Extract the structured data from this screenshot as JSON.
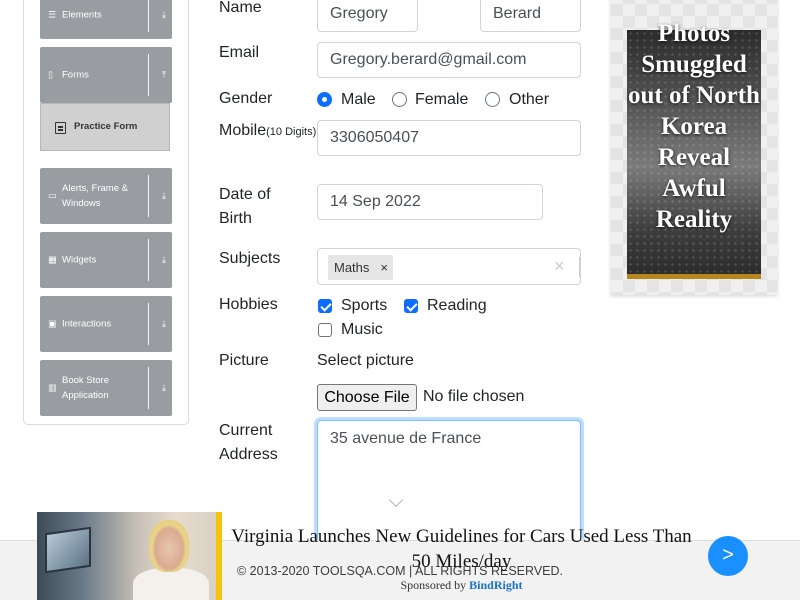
{
  "sidebar": {
    "groups": [
      {
        "label": "Elements",
        "icon": "list-icon"
      },
      {
        "label": "Forms",
        "icon": "document-icon"
      },
      {
        "label": "Alerts, Frame & Windows",
        "icon": "window-icon"
      },
      {
        "label": "Widgets",
        "icon": "grid-icon"
      },
      {
        "label": "Interactions",
        "icon": "interaction-icon"
      },
      {
        "label": "Book Store Application",
        "icon": "book-icon"
      }
    ],
    "active_item": {
      "label": "Practice Form",
      "icon": "form-icon"
    }
  },
  "form": {
    "name_label": "Name",
    "first_name": "Gregory",
    "last_name": "Berard",
    "email_label": "Email",
    "email": "Gregory.berard@gmail.com",
    "gender_label": "Gender",
    "gender_options": [
      "Male",
      "Female",
      "Other"
    ],
    "gender_selected": "Male",
    "mobile_label": "Mobile",
    "mobile_hint": "(10 Digits)",
    "mobile": "3306050407",
    "dob_label_1": "Date of",
    "dob_label_2": "Birth",
    "dob": "14 Sep 2022",
    "subjects_label": "Subjects",
    "subjects": [
      "Maths"
    ],
    "chip_remove": "×",
    "clear_symbol": "×",
    "hobbies_label": "Hobbies",
    "hobbies": [
      {
        "label": "Sports",
        "checked": true
      },
      {
        "label": "Reading",
        "checked": true
      },
      {
        "label": "Music",
        "checked": false
      }
    ],
    "picture_label": "Picture",
    "select_picture": "Select picture",
    "choose_file": "Choose File",
    "no_file": "No file chosen",
    "address_label_1": "Current",
    "address_label_2": "Address",
    "address": "35 avenue de France"
  },
  "side_ad": {
    "headline": "Photos Smuggled out of North Korea Reveal Awful Reality"
  },
  "footer": {
    "copyright": "© 2013-2020 TOOLSQA.COM | ALL RIGHTS RESERVED."
  },
  "bottom_ad": {
    "title": "Virginia Launches New Guidelines for Cars Used Less Than 50 Miles/day",
    "sponsored_by": "Sponsored by",
    "sponsor": "BindRight",
    "next": ">"
  },
  "colors": {
    "accent": "#0d6efd",
    "sidebar_header": "#999da1",
    "ad_next": "#1a8fff"
  }
}
